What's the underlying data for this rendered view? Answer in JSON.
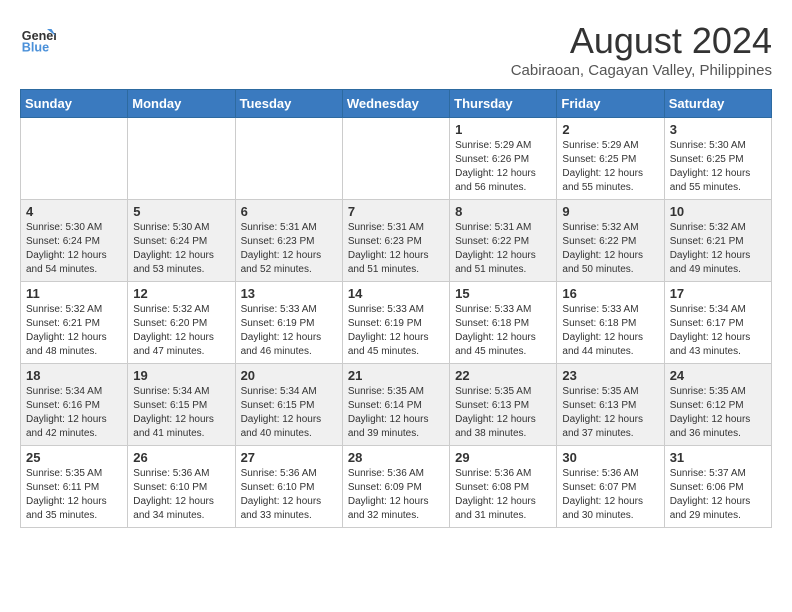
{
  "header": {
    "logo_line1": "General",
    "logo_line2": "Blue",
    "title": "August 2024",
    "subtitle": "Cabiraoan, Cagayan Valley, Philippines"
  },
  "weekdays": [
    "Sunday",
    "Monday",
    "Tuesday",
    "Wednesday",
    "Thursday",
    "Friday",
    "Saturday"
  ],
  "weeks": [
    [
      {
        "day": "",
        "info": ""
      },
      {
        "day": "",
        "info": ""
      },
      {
        "day": "",
        "info": ""
      },
      {
        "day": "",
        "info": ""
      },
      {
        "day": "1",
        "info": "Sunrise: 5:29 AM\nSunset: 6:26 PM\nDaylight: 12 hours\nand 56 minutes."
      },
      {
        "day": "2",
        "info": "Sunrise: 5:29 AM\nSunset: 6:25 PM\nDaylight: 12 hours\nand 55 minutes."
      },
      {
        "day": "3",
        "info": "Sunrise: 5:30 AM\nSunset: 6:25 PM\nDaylight: 12 hours\nand 55 minutes."
      }
    ],
    [
      {
        "day": "4",
        "info": "Sunrise: 5:30 AM\nSunset: 6:24 PM\nDaylight: 12 hours\nand 54 minutes."
      },
      {
        "day": "5",
        "info": "Sunrise: 5:30 AM\nSunset: 6:24 PM\nDaylight: 12 hours\nand 53 minutes."
      },
      {
        "day": "6",
        "info": "Sunrise: 5:31 AM\nSunset: 6:23 PM\nDaylight: 12 hours\nand 52 minutes."
      },
      {
        "day": "7",
        "info": "Sunrise: 5:31 AM\nSunset: 6:23 PM\nDaylight: 12 hours\nand 51 minutes."
      },
      {
        "day": "8",
        "info": "Sunrise: 5:31 AM\nSunset: 6:22 PM\nDaylight: 12 hours\nand 51 minutes."
      },
      {
        "day": "9",
        "info": "Sunrise: 5:32 AM\nSunset: 6:22 PM\nDaylight: 12 hours\nand 50 minutes."
      },
      {
        "day": "10",
        "info": "Sunrise: 5:32 AM\nSunset: 6:21 PM\nDaylight: 12 hours\nand 49 minutes."
      }
    ],
    [
      {
        "day": "11",
        "info": "Sunrise: 5:32 AM\nSunset: 6:21 PM\nDaylight: 12 hours\nand 48 minutes."
      },
      {
        "day": "12",
        "info": "Sunrise: 5:32 AM\nSunset: 6:20 PM\nDaylight: 12 hours\nand 47 minutes."
      },
      {
        "day": "13",
        "info": "Sunrise: 5:33 AM\nSunset: 6:19 PM\nDaylight: 12 hours\nand 46 minutes."
      },
      {
        "day": "14",
        "info": "Sunrise: 5:33 AM\nSunset: 6:19 PM\nDaylight: 12 hours\nand 45 minutes."
      },
      {
        "day": "15",
        "info": "Sunrise: 5:33 AM\nSunset: 6:18 PM\nDaylight: 12 hours\nand 45 minutes."
      },
      {
        "day": "16",
        "info": "Sunrise: 5:33 AM\nSunset: 6:18 PM\nDaylight: 12 hours\nand 44 minutes."
      },
      {
        "day": "17",
        "info": "Sunrise: 5:34 AM\nSunset: 6:17 PM\nDaylight: 12 hours\nand 43 minutes."
      }
    ],
    [
      {
        "day": "18",
        "info": "Sunrise: 5:34 AM\nSunset: 6:16 PM\nDaylight: 12 hours\nand 42 minutes."
      },
      {
        "day": "19",
        "info": "Sunrise: 5:34 AM\nSunset: 6:15 PM\nDaylight: 12 hours\nand 41 minutes."
      },
      {
        "day": "20",
        "info": "Sunrise: 5:34 AM\nSunset: 6:15 PM\nDaylight: 12 hours\nand 40 minutes."
      },
      {
        "day": "21",
        "info": "Sunrise: 5:35 AM\nSunset: 6:14 PM\nDaylight: 12 hours\nand 39 minutes."
      },
      {
        "day": "22",
        "info": "Sunrise: 5:35 AM\nSunset: 6:13 PM\nDaylight: 12 hours\nand 38 minutes."
      },
      {
        "day": "23",
        "info": "Sunrise: 5:35 AM\nSunset: 6:13 PM\nDaylight: 12 hours\nand 37 minutes."
      },
      {
        "day": "24",
        "info": "Sunrise: 5:35 AM\nSunset: 6:12 PM\nDaylight: 12 hours\nand 36 minutes."
      }
    ],
    [
      {
        "day": "25",
        "info": "Sunrise: 5:35 AM\nSunset: 6:11 PM\nDaylight: 12 hours\nand 35 minutes."
      },
      {
        "day": "26",
        "info": "Sunrise: 5:36 AM\nSunset: 6:10 PM\nDaylight: 12 hours\nand 34 minutes."
      },
      {
        "day": "27",
        "info": "Sunrise: 5:36 AM\nSunset: 6:10 PM\nDaylight: 12 hours\nand 33 minutes."
      },
      {
        "day": "28",
        "info": "Sunrise: 5:36 AM\nSunset: 6:09 PM\nDaylight: 12 hours\nand 32 minutes."
      },
      {
        "day": "29",
        "info": "Sunrise: 5:36 AM\nSunset: 6:08 PM\nDaylight: 12 hours\nand 31 minutes."
      },
      {
        "day": "30",
        "info": "Sunrise: 5:36 AM\nSunset: 6:07 PM\nDaylight: 12 hours\nand 30 minutes."
      },
      {
        "day": "31",
        "info": "Sunrise: 5:37 AM\nSunset: 6:06 PM\nDaylight: 12 hours\nand 29 minutes."
      }
    ]
  ]
}
